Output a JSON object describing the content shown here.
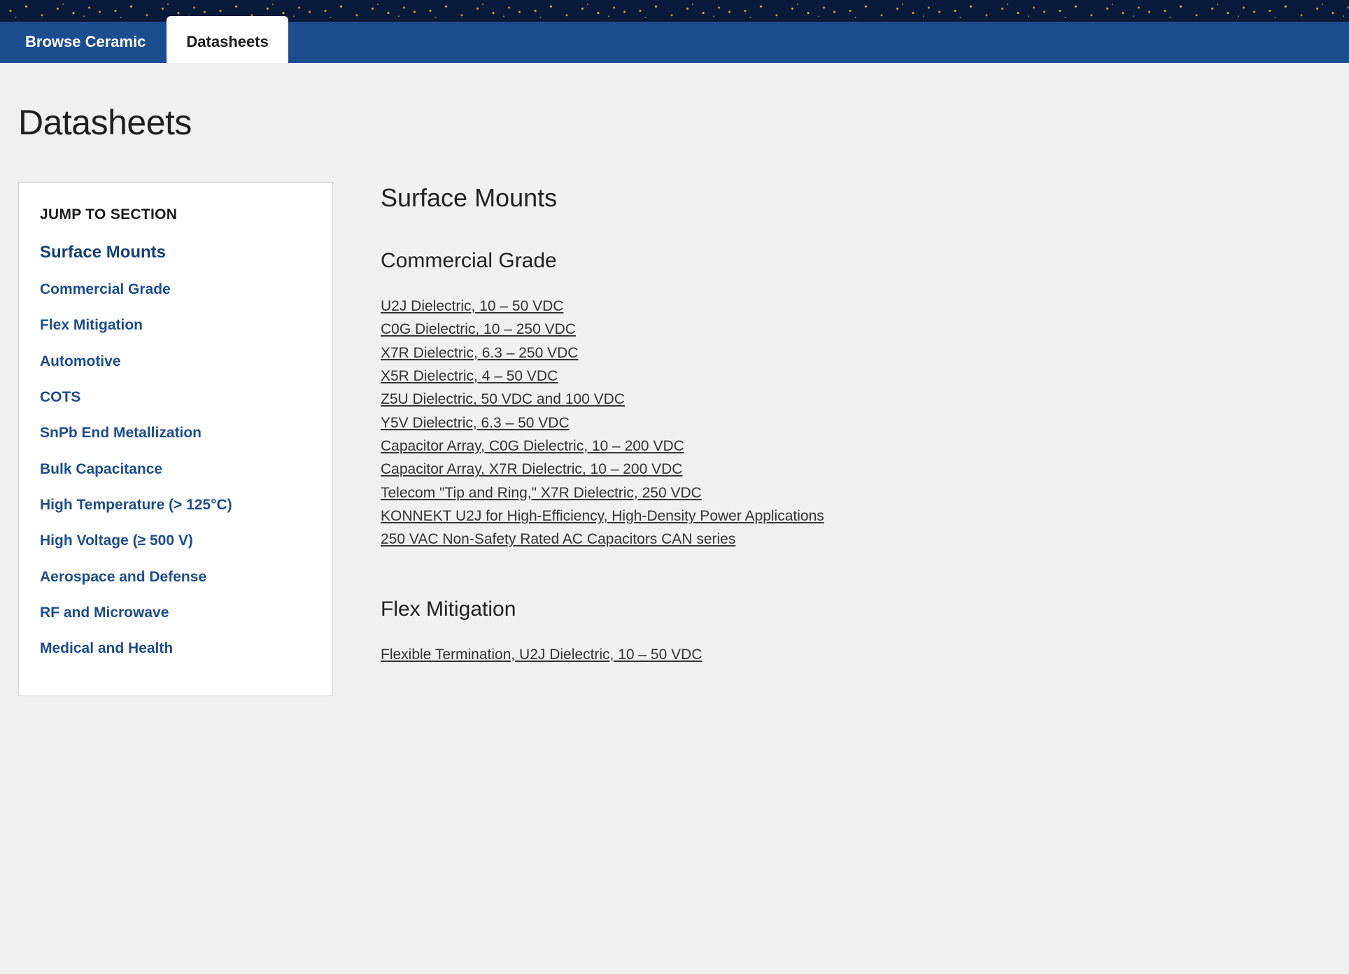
{
  "tabs": {
    "browse": "Browse Ceramic",
    "datasheets": "Datasheets"
  },
  "page_title": "Datasheets",
  "sidebar": {
    "title": "JUMP TO SECTION",
    "links": [
      "Surface Mounts",
      "Commercial Grade",
      "Flex Mitigation",
      "Automotive",
      "COTS",
      "SnPb End Metallization",
      "Bulk Capacitance",
      "High Temperature (> 125°C)",
      "High Voltage (≥ 500 V)",
      "Aerospace and Defense",
      "RF and Microwave",
      "Medical and Health"
    ]
  },
  "content": {
    "section1_title": "Surface Mounts",
    "commercial_grade": {
      "title": "Commercial Grade",
      "links": [
        "U2J Dielectric, 10 – 50 VDC",
        "C0G Dielectric, 10 – 250 VDC",
        "X7R Dielectric, 6.3 – 250 VDC",
        "X5R Dielectric, 4 – 50 VDC",
        "Z5U Dielectric, 50 VDC and 100 VDC",
        "Y5V Dielectric, 6.3 – 50 VDC",
        "Capacitor Array, C0G Dielectric, 10 – 200 VDC",
        "Capacitor Array, X7R Dielectric, 10 – 200 VDC",
        "Telecom \"Tip and Ring,\" X7R Dielectric, 250 VDC",
        "KONNEKT U2J for High-Efficiency, High-Density Power Applications",
        "250 VAC Non-Safety Rated AC Capacitors CAN series"
      ]
    },
    "flex_mitigation": {
      "title": "Flex Mitigation",
      "links": [
        "Flexible Termination, U2J Dielectric, 10 – 50 VDC"
      ]
    }
  }
}
